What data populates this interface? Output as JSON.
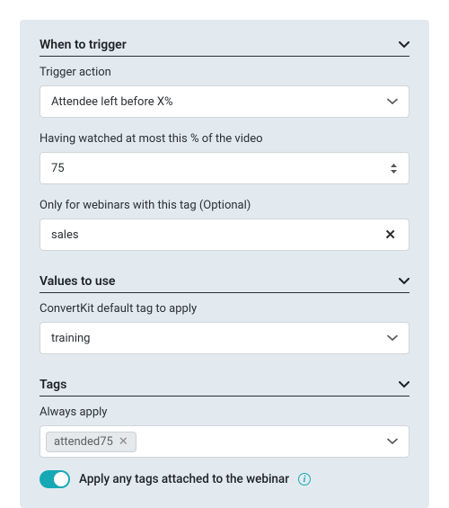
{
  "sections": {
    "trigger": {
      "title": "When to trigger",
      "fields": {
        "action": {
          "label": "Trigger action",
          "value": "Attendee left before X%"
        },
        "percent": {
          "label": "Having watched at most this % of the video",
          "value": "75"
        },
        "tag_filter": {
          "label": "Only for webinars with this tag (Optional)",
          "value": "sales"
        }
      }
    },
    "values": {
      "title": "Values to use",
      "fields": {
        "default_tag": {
          "label": "ConvertKit default tag to apply",
          "value": "training"
        }
      }
    },
    "tags": {
      "title": "Tags",
      "fields": {
        "always": {
          "label": "Always apply",
          "chips": [
            "attended75"
          ]
        }
      },
      "toggle": {
        "label": "Apply any tags attached to the webinar",
        "on": true
      }
    }
  }
}
